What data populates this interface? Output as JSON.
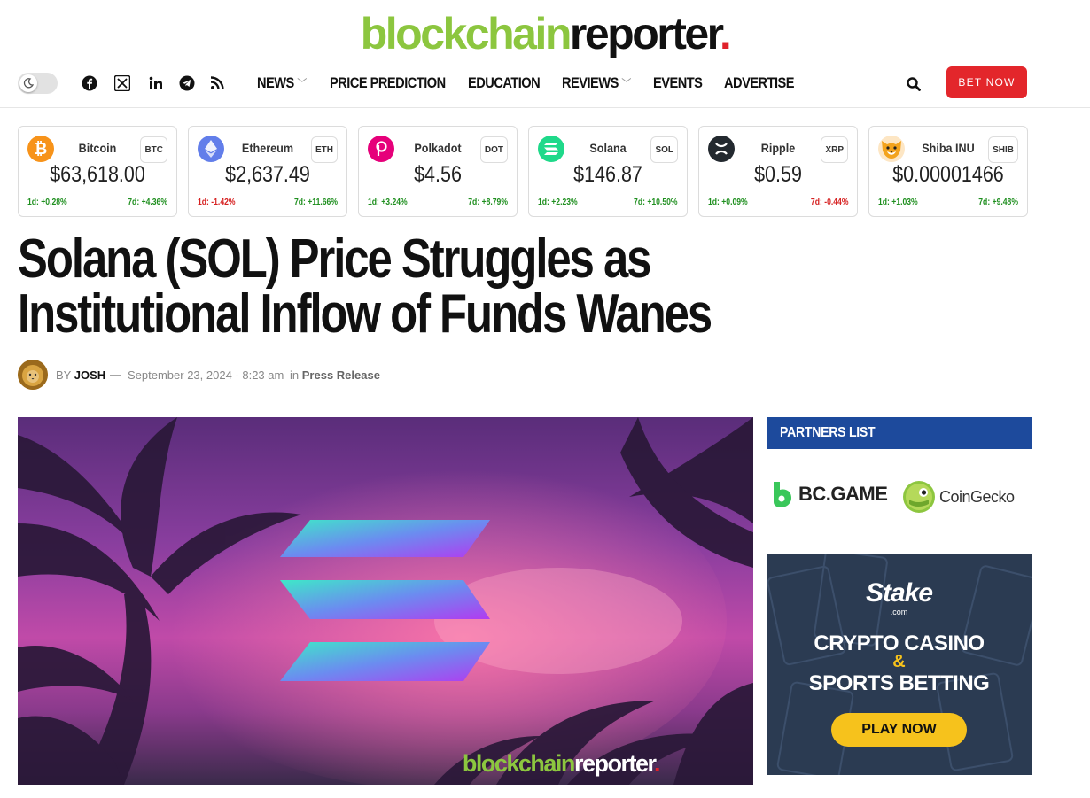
{
  "site": {
    "logo_part1": "blockchain",
    "logo_part2": "reporter",
    "logo_dot": "."
  },
  "nav": {
    "social_icons": [
      "facebook-icon",
      "x-twitter-icon",
      "linkedin-icon",
      "telegram-icon",
      "rss-icon"
    ],
    "menu": [
      {
        "label": "NEWS",
        "has_dropdown": true
      },
      {
        "label": "PRICE PREDICTION",
        "has_dropdown": false
      },
      {
        "label": "EDUCATION",
        "has_dropdown": false
      },
      {
        "label": "REVIEWS",
        "has_dropdown": true
      },
      {
        "label": "EVENTS",
        "has_dropdown": false
      },
      {
        "label": "ADVERTISE",
        "has_dropdown": false
      }
    ],
    "cta_label": "BET NOW",
    "cta_color": "#e3262b"
  },
  "ticker": [
    {
      "name": "Bitcoin",
      "symbol": "BTC",
      "price": "$63,618.00",
      "d1": "1d: +0.28%",
      "d7": "7d: +4.36%",
      "d1_trend": "up",
      "d7_trend": "up",
      "color": "#f7931a"
    },
    {
      "name": "Ethereum",
      "symbol": "ETH",
      "price": "$2,637.49",
      "d1": "1d: -1.42%",
      "d7": "7d: +11.66%",
      "d1_trend": "down",
      "d7_trend": "up",
      "color": "#627eea"
    },
    {
      "name": "Polkadot",
      "symbol": "DOT",
      "price": "$4.56",
      "d1": "1d: +3.24%",
      "d7": "7d: +8.79%",
      "d1_trend": "up",
      "d7_trend": "up",
      "color": "#e6007a"
    },
    {
      "name": "Solana",
      "symbol": "SOL",
      "price": "$146.87",
      "d1": "1d: +2.23%",
      "d7": "7d: +10.50%",
      "d1_trend": "up",
      "d7_trend": "up",
      "color": "#1fd98a"
    },
    {
      "name": "Ripple",
      "symbol": "XRP",
      "price": "$0.59",
      "d1": "1d: +0.09%",
      "d7": "7d: -0.44%",
      "d1_trend": "up",
      "d7_trend": "down",
      "color": "#23292f"
    },
    {
      "name": "Shiba INU",
      "symbol": "SHIB",
      "price": "$0.00001466",
      "d1": "1d: +1.03%",
      "d7": "7d: +9.48%",
      "d1_trend": "up",
      "d7_trend": "up",
      "color": "#f3a31d"
    }
  ],
  "article": {
    "title": "Solana (SOL) Price Struggles as Institutional Inflow of Funds Wanes",
    "by": "BY",
    "author": "JOSH",
    "dash": "—",
    "date": "September 23, 2024 - 8:23 am",
    "in_label": "in",
    "category": "Press Release",
    "hero_watermark_1": "blockchain",
    "hero_watermark_2": "reporter",
    "hero_watermark_dot": "."
  },
  "sidebar": {
    "partners_title": "PARTNERS LIST",
    "partner_1": "BC.GAME",
    "partner_2": "CoinGecko",
    "ad": {
      "brand": "Stake",
      "brand_sub": ".com",
      "line1": "CRYPTO CASINO",
      "line2": "&",
      "line3": "SPORTS BETTING",
      "cta": "PLAY NOW"
    }
  }
}
